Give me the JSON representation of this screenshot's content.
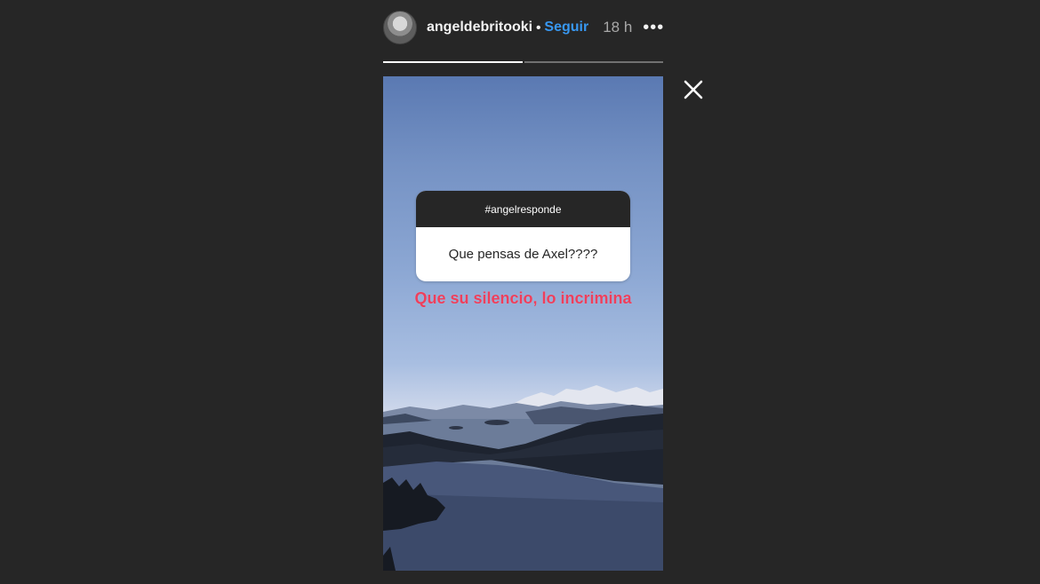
{
  "header": {
    "username": "angeldebritooki",
    "separator": "•",
    "follow_label": "Seguir",
    "time": "18 h",
    "more_label": "•••"
  },
  "progress": {
    "segments": 2,
    "completed": 1
  },
  "story": {
    "question_title": "#angelresponde",
    "question_text": "Que pensas de Axel????",
    "answer_text": "Que su silencio, lo incrimina"
  },
  "icons": {
    "close": "close-icon",
    "more": "more-icon",
    "avatar": "avatar"
  },
  "colors": {
    "background": "#262626",
    "follow": "#3897f0",
    "answer": "#ee3f5c"
  }
}
